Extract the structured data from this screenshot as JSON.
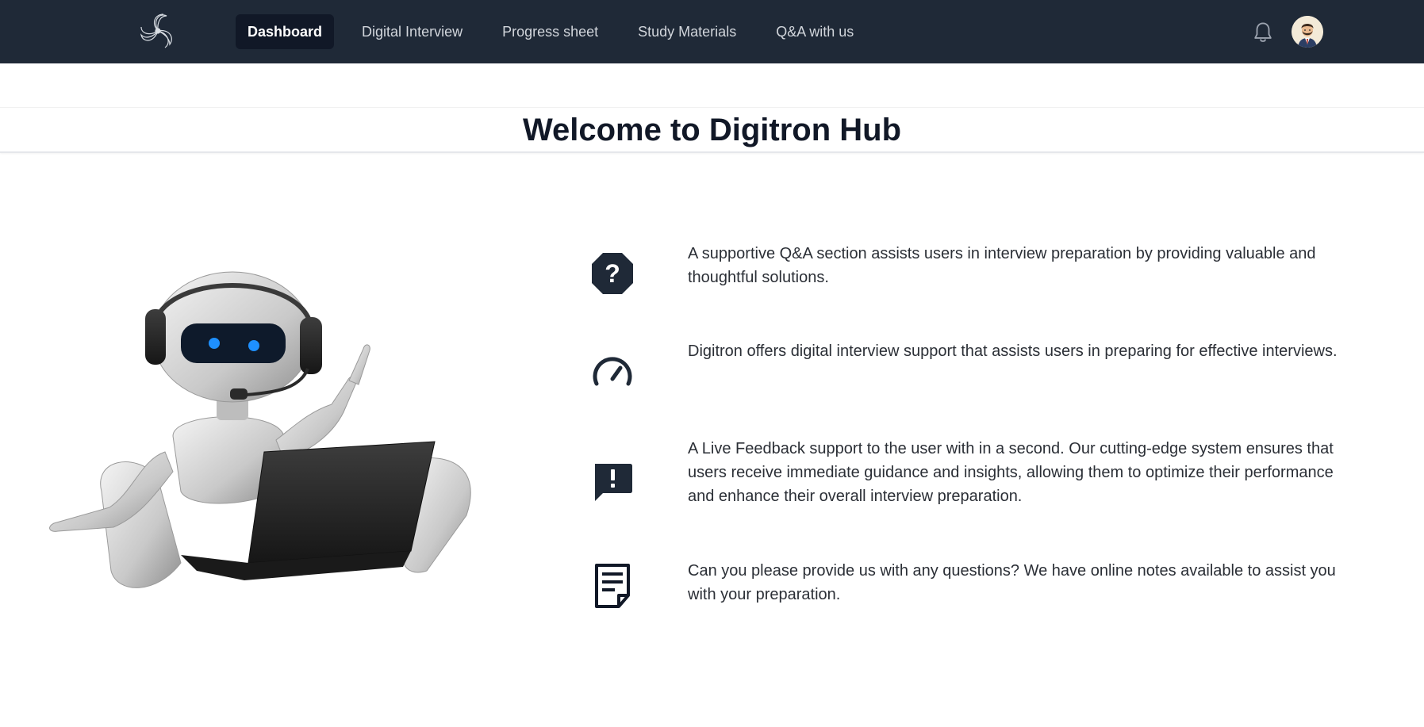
{
  "nav": {
    "items": [
      {
        "label": "Dashboard",
        "active": true
      },
      {
        "label": "Digital Interview",
        "active": false
      },
      {
        "label": "Progress sheet",
        "active": false
      },
      {
        "label": "Study Materials",
        "active": false
      },
      {
        "label": "Q&A with us",
        "active": false
      }
    ],
    "icons": {
      "logo": "swirl-logo",
      "notifications": "bell-icon",
      "profile": "avatar"
    }
  },
  "page": {
    "title": "Welcome to Digitron Hub"
  },
  "features": [
    {
      "icon": "question-octagon-icon",
      "text": "A supportive Q&A section assists users in interview preparation by providing valuable and thoughtful solutions."
    },
    {
      "icon": "speedometer-icon",
      "text": "Digitron offers digital interview support that assists users in preparing for effective interviews."
    },
    {
      "icon": "feedback-message-icon",
      "text": "A Live Feedback support to the user with in a second. Our cutting-edge system ensures that users receive immediate guidance and insights, allowing them to optimize their performance and enhance their overall interview preparation."
    },
    {
      "icon": "notes-document-icon",
      "text": "Can you please provide us with any questions? We have online notes available to assist you with your preparation."
    }
  ],
  "colors": {
    "navbar": "#1f2937",
    "nav_active": "#111827",
    "title": "#111827",
    "body_text": "#2b2f36"
  }
}
